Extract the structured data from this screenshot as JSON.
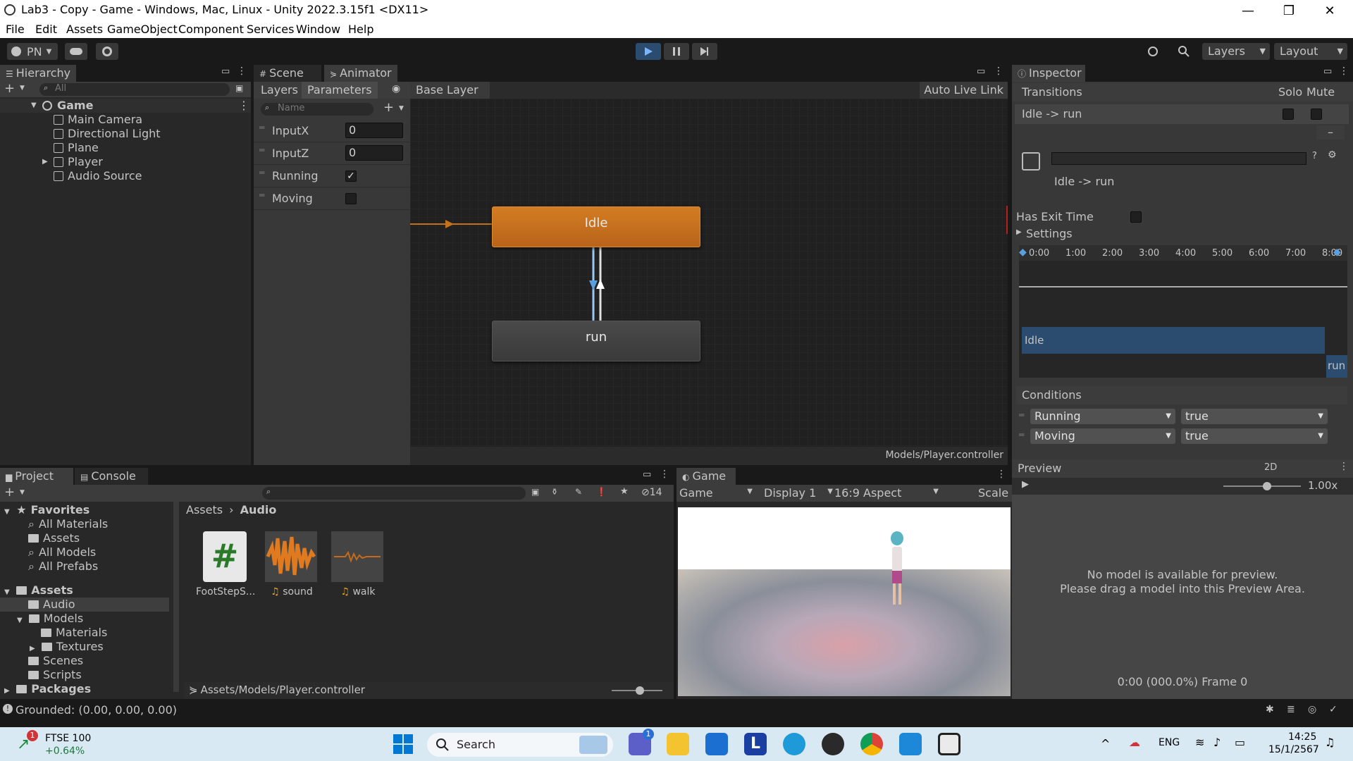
{
  "window": {
    "title": "Lab3 - Copy - Game - Windows, Mac, Linux - Unity 2022.3.15f1 <DX11>",
    "controls": [
      "—",
      "❐",
      "✕"
    ]
  },
  "menu": [
    "File",
    "Edit",
    "Assets",
    "GameObject",
    "Component",
    "Services",
    "Window",
    "Help"
  ],
  "toolbar": {
    "account": "PN",
    "layers_label": "Layers",
    "layout_label": "Layout"
  },
  "hierarchy": {
    "tab": "Hierarchy",
    "search_placeholder": "All",
    "root": "Game",
    "items": [
      "Main Camera",
      "Directional Light",
      "Plane",
      "Player",
      "Audio Source"
    ]
  },
  "animator": {
    "tabs": [
      "Scene",
      "Animator"
    ],
    "subtabs": [
      "Layers",
      "Parameters"
    ],
    "breadcrumb": "Base Layer",
    "auto_live_link": "Auto Live Link",
    "search_placeholder": "Name",
    "params": [
      {
        "name": "InputX",
        "value": "0",
        "type": "float"
      },
      {
        "name": "InputZ",
        "value": "0",
        "type": "float"
      },
      {
        "name": "Running",
        "value": "✓",
        "type": "bool",
        "checked": true
      },
      {
        "name": "Moving",
        "value": "",
        "type": "bool",
        "checked": false
      }
    ],
    "states": {
      "idle": "Idle",
      "run": "run"
    },
    "footer_path": "Models/Player.controller"
  },
  "inspector": {
    "tab": "Inspector",
    "transitions_label": "Transitions",
    "solo": "Solo",
    "mute": "Mute",
    "transition_name": "Idle -> run",
    "transition_title": "Idle -> run",
    "has_exit_time": "Has Exit Time",
    "settings": "Settings",
    "timeline_ticks": [
      "0:00",
      "1:00",
      "2:00",
      "3:00",
      "4:00",
      "5:00",
      "6:00",
      "7:00",
      "8:00"
    ],
    "timeline_idle": "Idle",
    "timeline_run": "run",
    "conditions_label": "Conditions",
    "conditions": [
      {
        "param": "Running",
        "value": "true"
      },
      {
        "param": "Moving",
        "value": "true"
      }
    ],
    "preview": "Preview",
    "preview_2d": "2D",
    "preview_speed": "1.00x",
    "preview_msg1": "No model is available for preview.",
    "preview_msg2": "Please drag a model into this Preview Area.",
    "preview_frame": "0:00 (000.0%) Frame 0"
  },
  "project": {
    "tabs": [
      "Project",
      "Console"
    ],
    "favorites_label": "Favorites",
    "favorites": [
      "All Materials",
      "Assets",
      "All Models",
      "All Prefabs"
    ],
    "assets_label": "Assets",
    "tree": [
      "Audio",
      "Models",
      "Materials",
      "Textures",
      "Scenes",
      "Scripts"
    ],
    "packages_label": "Packages",
    "breadcrumb": [
      "Assets",
      "Audio"
    ],
    "hidden_count": "14",
    "files": [
      "FootStepS...",
      "sound",
      "walk"
    ],
    "footer_path": "Assets/Models/Player.controller"
  },
  "game": {
    "tab": "Game",
    "mode": "Game",
    "display": "Display 1",
    "aspect": "16:9 Aspect",
    "scale": "Scale"
  },
  "status": {
    "message": "Grounded: (0.00, 0.00, 0.00)"
  },
  "taskbar": {
    "stock_name": "FTSE 100",
    "stock_change": "+0.64%",
    "badge": "1",
    "search": "Search",
    "chat_badge": "1",
    "lang": "ENG",
    "time": "14:25",
    "date": "15/1/2567",
    "l_icon": "L"
  },
  "colors": {
    "accent": "#3a79bb",
    "idle_state": "#c4711d",
    "panel": "#282828",
    "dark": "#191919"
  }
}
